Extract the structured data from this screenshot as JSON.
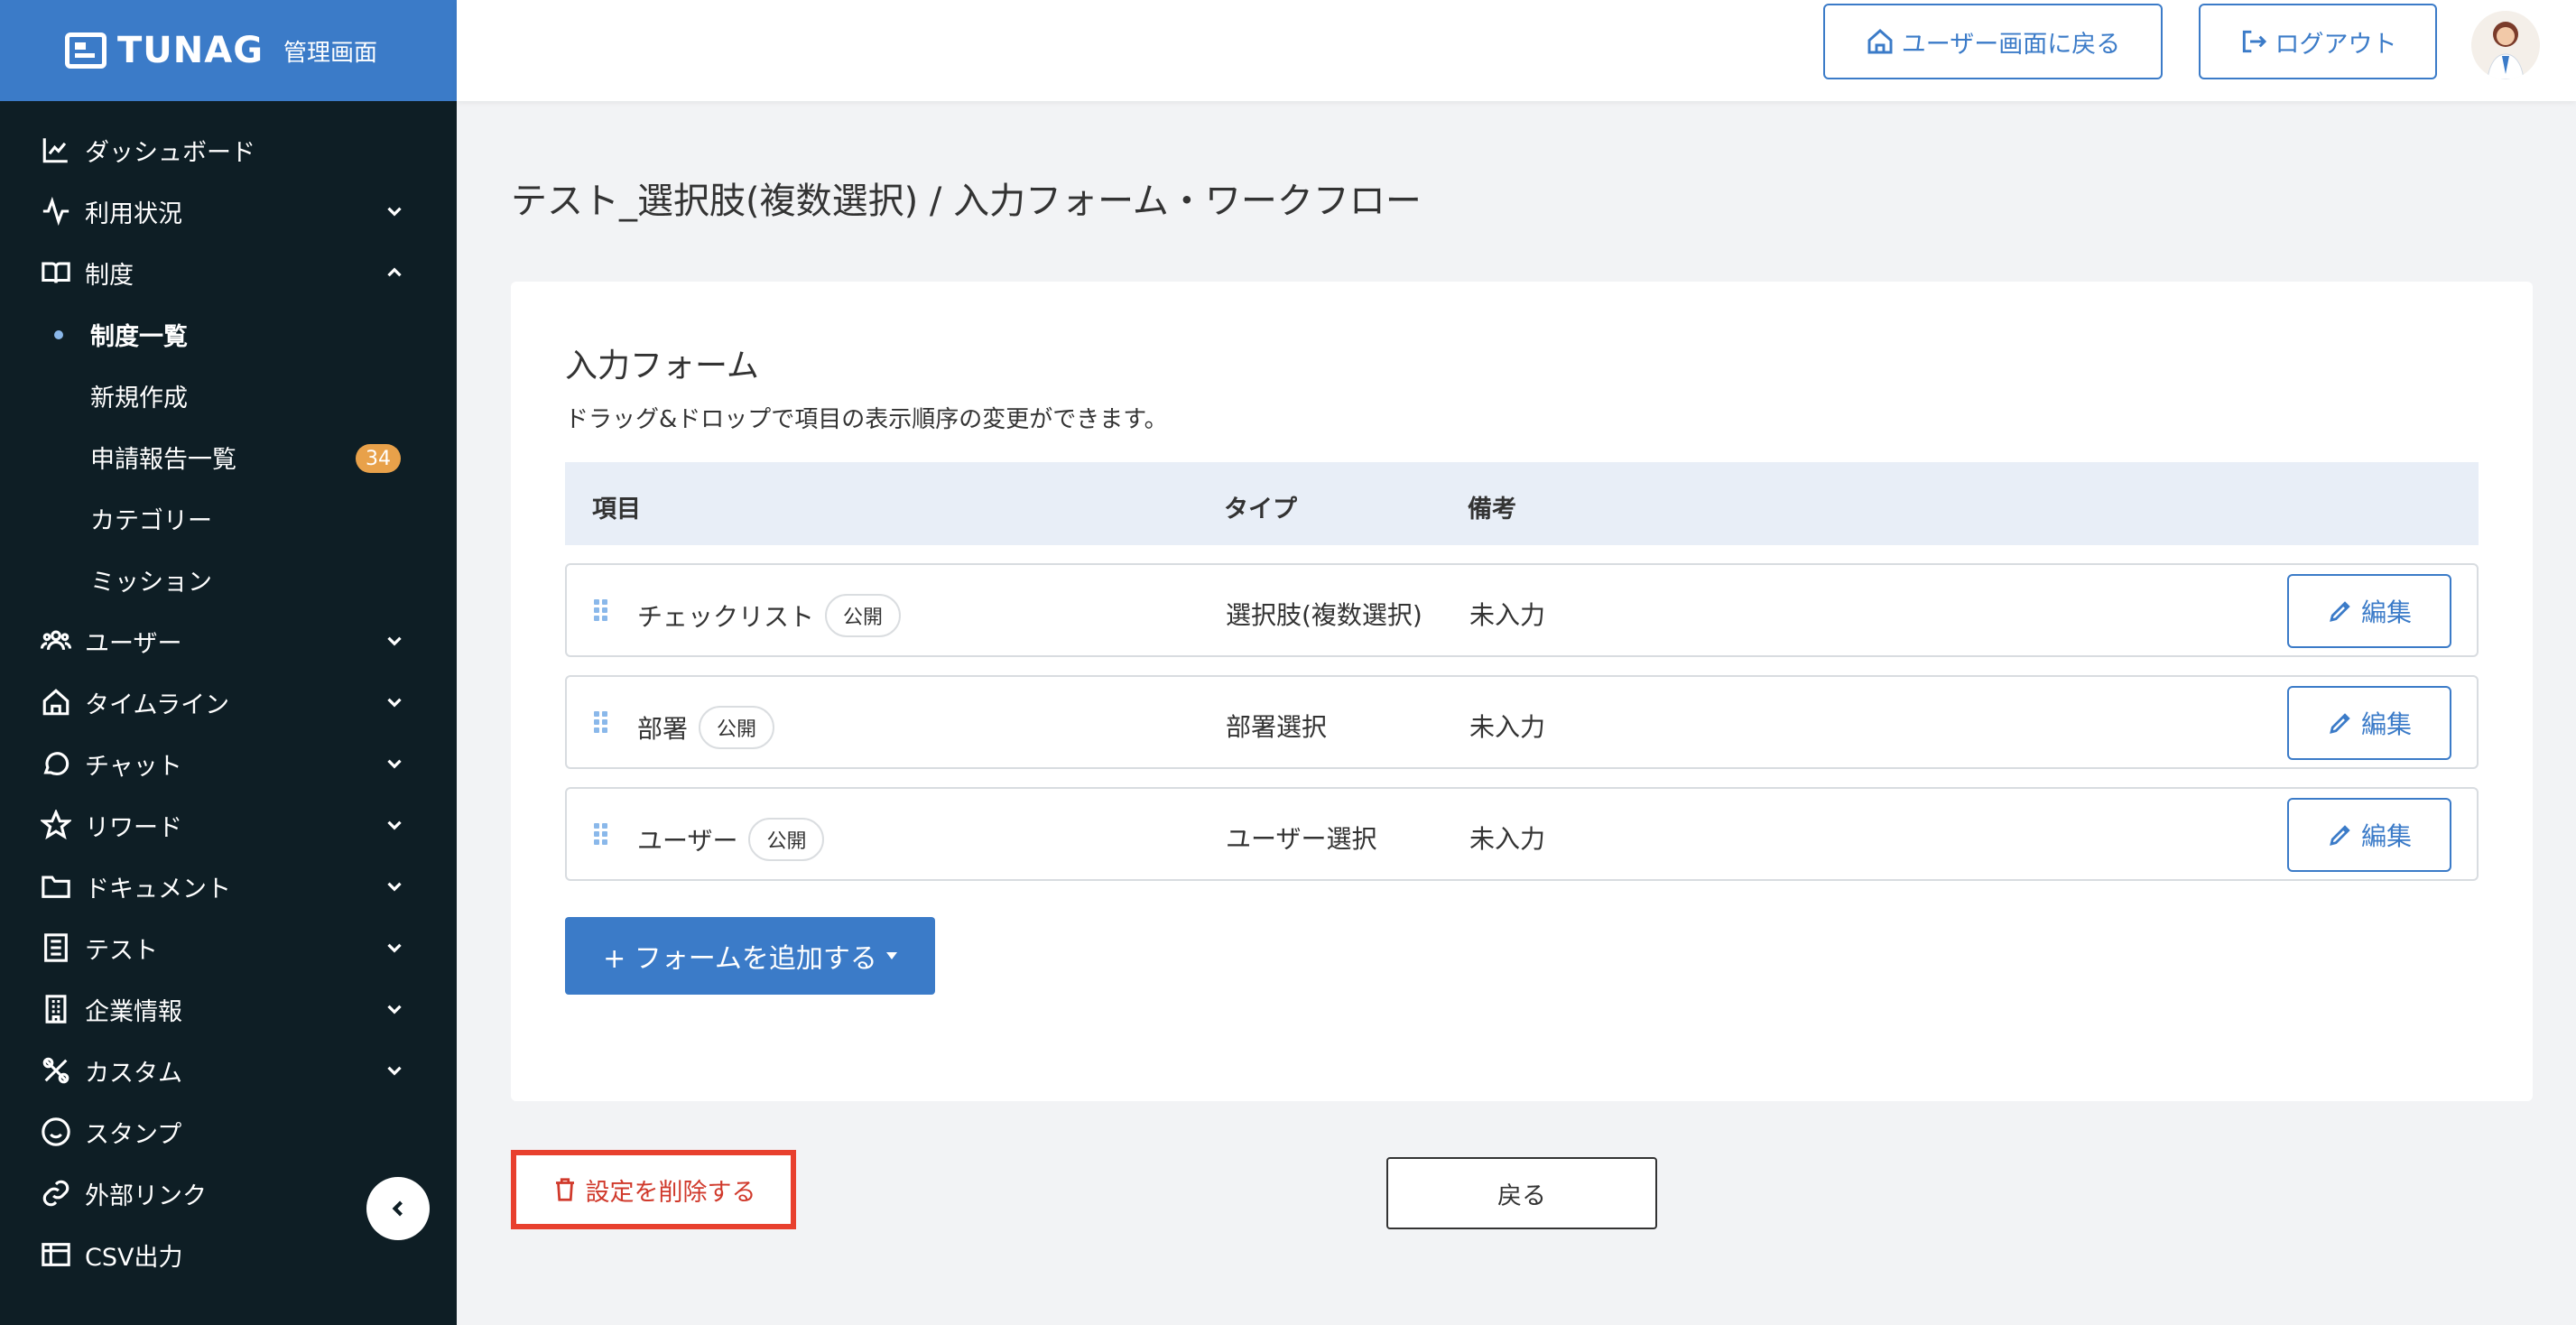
{
  "brand": {
    "name": "TUNAG",
    "subtitle": "管理画面"
  },
  "sidebar": {
    "items": [
      {
        "label": "ダッシュボード",
        "icon": "chart-line-icon"
      },
      {
        "label": "利用状況",
        "icon": "activity-icon",
        "expandable": true
      },
      {
        "label": "制度",
        "icon": "book-open-icon",
        "expanded": true,
        "children": [
          {
            "label": "制度一覧",
            "active": true
          },
          {
            "label": "新規作成"
          },
          {
            "label": "申請報告一覧",
            "badge": "34"
          },
          {
            "label": "カテゴリー"
          },
          {
            "label": "ミッション"
          }
        ]
      },
      {
        "label": "ユーザー",
        "icon": "users-icon",
        "expandable": true
      },
      {
        "label": "タイムライン",
        "icon": "home-icon",
        "expandable": true
      },
      {
        "label": "チャット",
        "icon": "chat-icon",
        "expandable": true
      },
      {
        "label": "リワード",
        "icon": "star-icon",
        "expandable": true
      },
      {
        "label": "ドキュメント",
        "icon": "folder-icon",
        "expandable": true
      },
      {
        "label": "テスト",
        "icon": "checklist-icon",
        "expandable": true
      },
      {
        "label": "企業情報",
        "icon": "building-icon",
        "expandable": true
      },
      {
        "label": "カスタム",
        "icon": "tools-icon",
        "expandable": true
      },
      {
        "label": "スタンプ",
        "icon": "smile-icon"
      },
      {
        "label": "外部リンク",
        "icon": "link-icon"
      },
      {
        "label": "CSV出力",
        "icon": "table-icon"
      }
    ]
  },
  "header": {
    "user_screen_button": "ユーザー画面に戻る",
    "logout_button": "ログアウト"
  },
  "page": {
    "title": "テスト_選択肢(複数選択) / 入力フォーム・ワークフロー"
  },
  "form": {
    "title": "入力フォーム",
    "description": "ドラッグ&ドロップで項目の表示順序の変更ができます。",
    "columns": [
      "項目",
      "タイプ",
      "備考"
    ],
    "rows": [
      {
        "name": "チェックリスト",
        "status": "公開",
        "type": "選択肢(複数選択)",
        "note": "未入力",
        "edit": "編集"
      },
      {
        "name": "部署",
        "status": "公開",
        "type": "部署選択",
        "note": "未入力",
        "edit": "編集"
      },
      {
        "name": "ユーザー",
        "status": "公開",
        "type": "ユーザー選択",
        "note": "未入力",
        "edit": "編集"
      }
    ],
    "add_button": "+ フォームを追加する"
  },
  "footer": {
    "delete_button": "設定を削除する",
    "back_button": "戻る"
  },
  "colors": {
    "brand": "#3b7bc8",
    "sidebar": "#0e1e25",
    "danger": "#e8402e",
    "badge": "#e8a14a"
  }
}
